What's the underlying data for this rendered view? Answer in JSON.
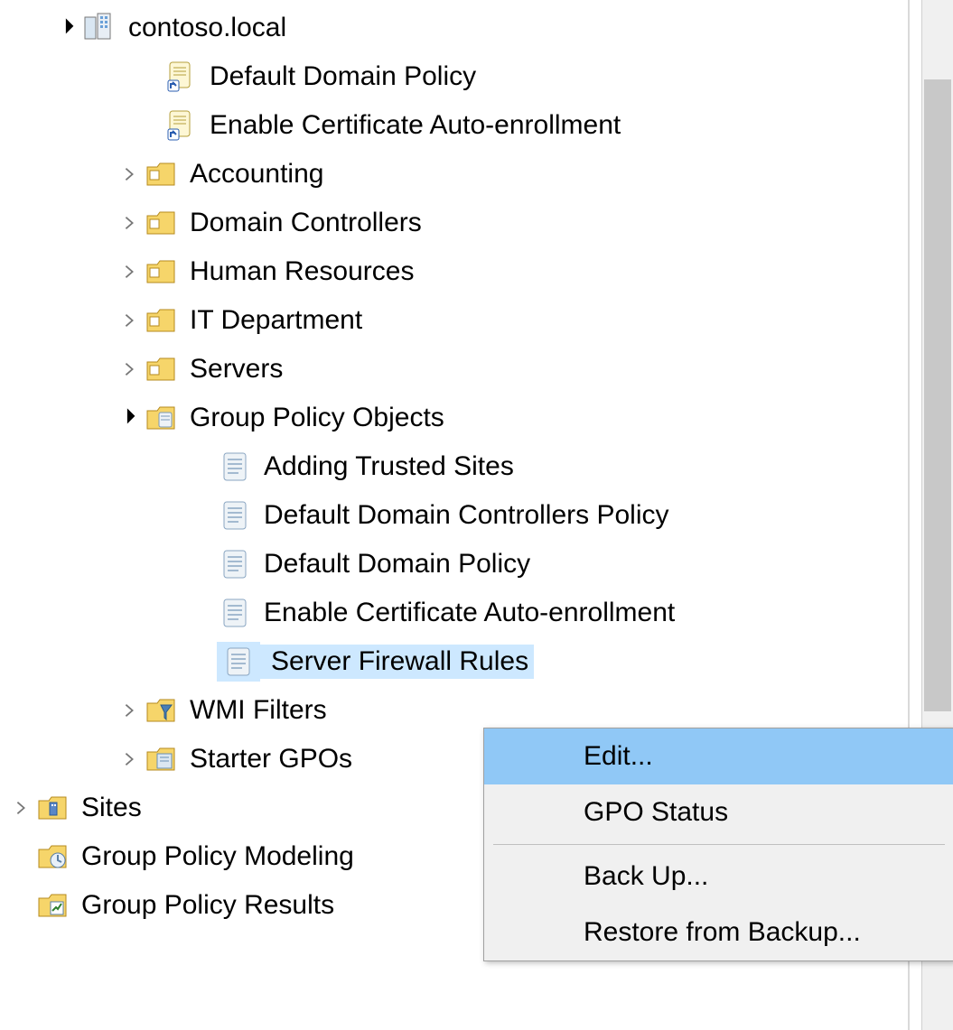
{
  "tree": {
    "domain": "contoso.local",
    "linked_gpos": [
      "Default Domain Policy",
      "Enable Certificate Auto-enrollment"
    ],
    "ous": [
      "Accounting",
      "Domain Controllers",
      "Human Resources",
      "IT Department",
      "Servers"
    ],
    "gpo_container": "Group Policy Objects",
    "gpos": [
      "Adding Trusted Sites",
      "Default Domain Controllers Policy",
      "Default Domain Policy",
      "Enable Certificate Auto-enrollment",
      "Server Firewall Rules"
    ],
    "gpo_selected_index": 4,
    "wmi_filters": "WMI Filters",
    "starter_gpos": "Starter GPOs",
    "sites": "Sites",
    "gp_modeling": "Group Policy Modeling",
    "gp_results": "Group Policy Results"
  },
  "context_menu": {
    "items": [
      "Edit...",
      "GPO Status",
      "Back  Up...",
      "Restore from Backup..."
    ],
    "highlighted_index": 0,
    "separator_after_index": 1
  }
}
